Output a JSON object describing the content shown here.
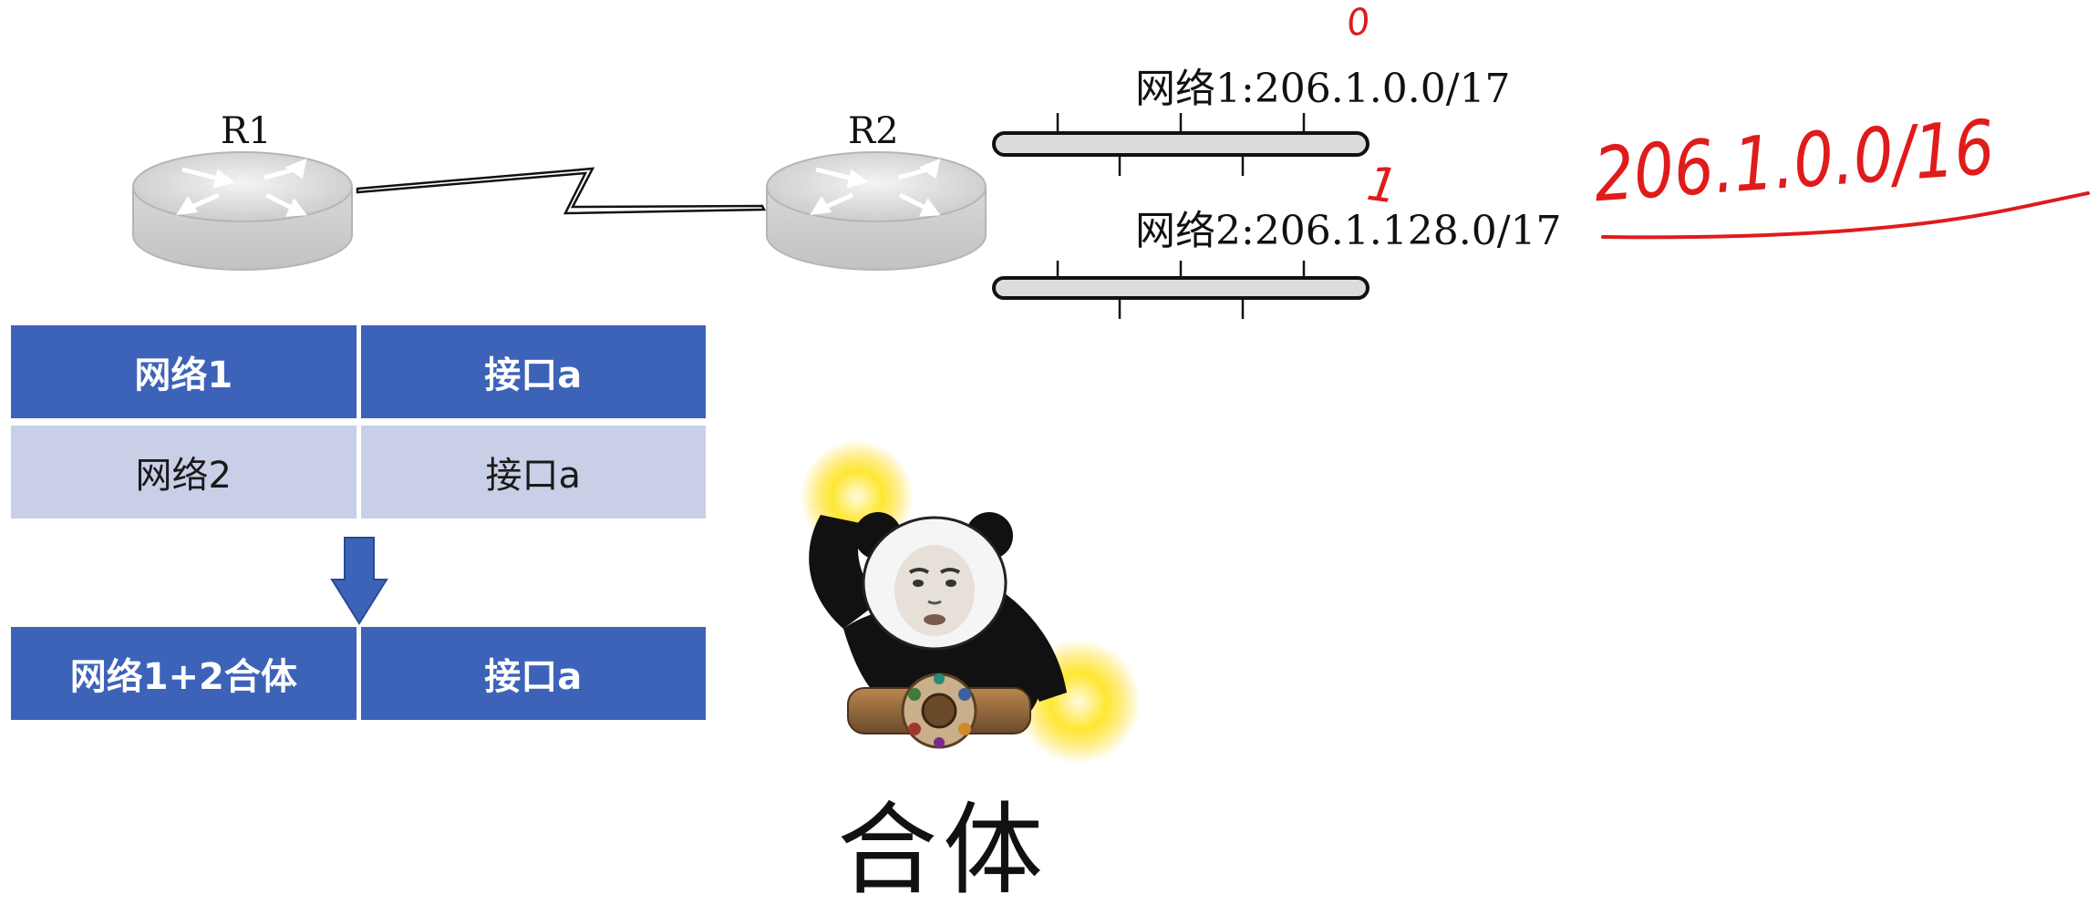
{
  "routers": [
    {
      "label": "R1"
    },
    {
      "label": "R2"
    }
  ],
  "networks": [
    {
      "label": "网络1:206.1.0.0/17"
    },
    {
      "label": "网络2:206.1.128.0/17"
    }
  ],
  "annotations": {
    "bit_zero": "0",
    "bit_one": "1",
    "supernet": "206.1.0.0/16"
  },
  "table_top": {
    "rows": [
      {
        "network": "网络1",
        "interface": "接口a"
      },
      {
        "network": "网络2",
        "interface": "接口a"
      }
    ]
  },
  "table_merged": {
    "rows": [
      {
        "network": "网络1+2合体",
        "interface": "接口a"
      }
    ]
  },
  "meme": {
    "caption": "合体",
    "description_icon": "panda-meme"
  },
  "colors": {
    "table_dark": "#3d63b9",
    "table_light": "#c8cfe6",
    "arrow": "#3d63b9",
    "annotation": "#e01b1b"
  }
}
